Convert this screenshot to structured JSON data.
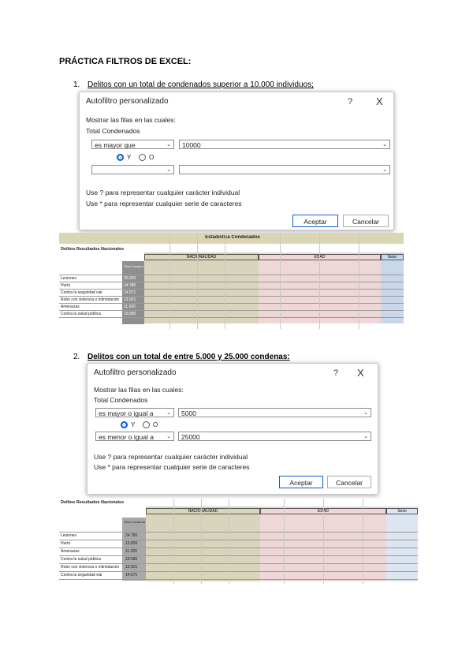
{
  "title": "PRÁCTICA FILTROS DE EXCEL:",
  "items": [
    {
      "num": "1.",
      "text": "Delitos con un total de condenados superior a 10.000 individuos;"
    },
    {
      "num": "2.",
      "text": "Delitos con un total de entre 5.000 y 25.000 condenas:"
    }
  ],
  "dialog1": {
    "title": "Autofiltro personalizado",
    "help": "?",
    "close": "X",
    "show_rows": "Mostrar las filas en las cuales:",
    "field": "Total Condenados",
    "op1": "es mayor que",
    "val1": "10000",
    "op2": "",
    "val2": "",
    "and_label": "Y",
    "or_label": "O",
    "hint1": "Use ? para representar cualquier carácter individual",
    "hint2": "Use * para representar cualquier serie de caracteres",
    "accept": "Aceptar",
    "cancel": "Cancelar"
  },
  "dialog2": {
    "title": "Autofiltro personalizado",
    "help": "?",
    "close": "X",
    "show_rows": "Mostrar las filas en las cuales:",
    "field": "Total Condenados",
    "op1": "es mayor o igual a",
    "val1": "5000",
    "op2": "es menor o igual a",
    "val2": "25000",
    "and_label": "Y",
    "or_label": "O",
    "hint1": "Use ? para representar cualquier carácter individual",
    "hint2": "Use * para representar cualquier serie de caracteres",
    "accept": "Aceptar",
    "cancel": "Cancelar"
  },
  "sheet1": {
    "banner": "Estadística Condenados",
    "subtitle": "Delitos Resultados Nacionales",
    "group_a": "NACIONALIDAD",
    "group_b": "EDAD",
    "group_c": "Sexo",
    "total_header": "Total Condenados",
    "rows": [
      "Lesiones",
      "Hurto",
      "Contra la seguridad vial",
      "Robo con violencia o intimidación",
      "Amenazas",
      "Contra la salud pública"
    ],
    "totals": [
      "30.925",
      "24.780",
      "14.571",
      "13.921",
      "11.020",
      "10.580"
    ]
  },
  "sheet2": {
    "subtitle": "Delitos Resultados Nacionales",
    "group_a": "NACIONALIDAD",
    "group_b": "EDAD",
    "group_c": "Sexo",
    "total_header": "Total Condenados",
    "rows": [
      "Lesiones",
      "Hurto",
      "Amenazas",
      "Contra la salud pública",
      "Robo con violencia o intimidación",
      "Contra la seguridad vial"
    ],
    "totals": [
      "24.780",
      "13.826",
      "11.020",
      "10.580",
      "13.921",
      "14.571"
    ]
  }
}
